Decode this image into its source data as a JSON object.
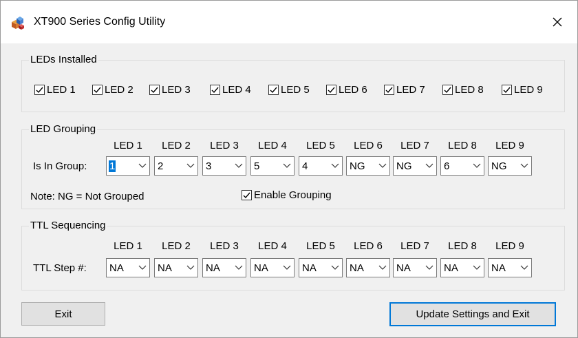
{
  "window": {
    "title": "XT900 Series Config Utility",
    "close_label": "✕"
  },
  "leds_installed": {
    "label": "LEDs Installed",
    "items": [
      {
        "label": "LED 1",
        "checked": true
      },
      {
        "label": "LED 2",
        "checked": true
      },
      {
        "label": "LED 3",
        "checked": true
      },
      {
        "label": "LED 4",
        "checked": true
      },
      {
        "label": "LED 5",
        "checked": true
      },
      {
        "label": "LED 6",
        "checked": true
      },
      {
        "label": "LED 7",
        "checked": true
      },
      {
        "label": "LED 8",
        "checked": true
      },
      {
        "label": "LED 9",
        "checked": true
      }
    ]
  },
  "led_grouping": {
    "label": "LED Grouping",
    "columns": [
      "LED 1",
      "LED 2",
      "LED 3",
      "LED 4",
      "LED 5",
      "LED 6",
      "LED 7",
      "LED 8",
      "LED 9"
    ],
    "row_label": "Is In Group:",
    "values": [
      "1",
      "2",
      "3",
      "5",
      "4",
      "NG",
      "NG",
      "6",
      "NG"
    ],
    "note": "Note: NG = Not Grouped",
    "enable_label": "Enable Grouping",
    "enable_checked": true
  },
  "ttl_sequencing": {
    "label": "TTL Sequencing",
    "columns": [
      "LED 1",
      "LED 2",
      "LED 3",
      "LED 4",
      "LED 5",
      "LED 6",
      "LED 7",
      "LED 8",
      "LED 9"
    ],
    "row_label": "TTL Step #:",
    "values": [
      "NA",
      "NA",
      "NA",
      "NA",
      "NA",
      "NA",
      "NA",
      "NA",
      "NA"
    ]
  },
  "buttons": {
    "exit": "Exit",
    "update": "Update Settings and Exit"
  },
  "colors": {
    "accent": "#0078d7",
    "background": "#f0f0f0"
  }
}
